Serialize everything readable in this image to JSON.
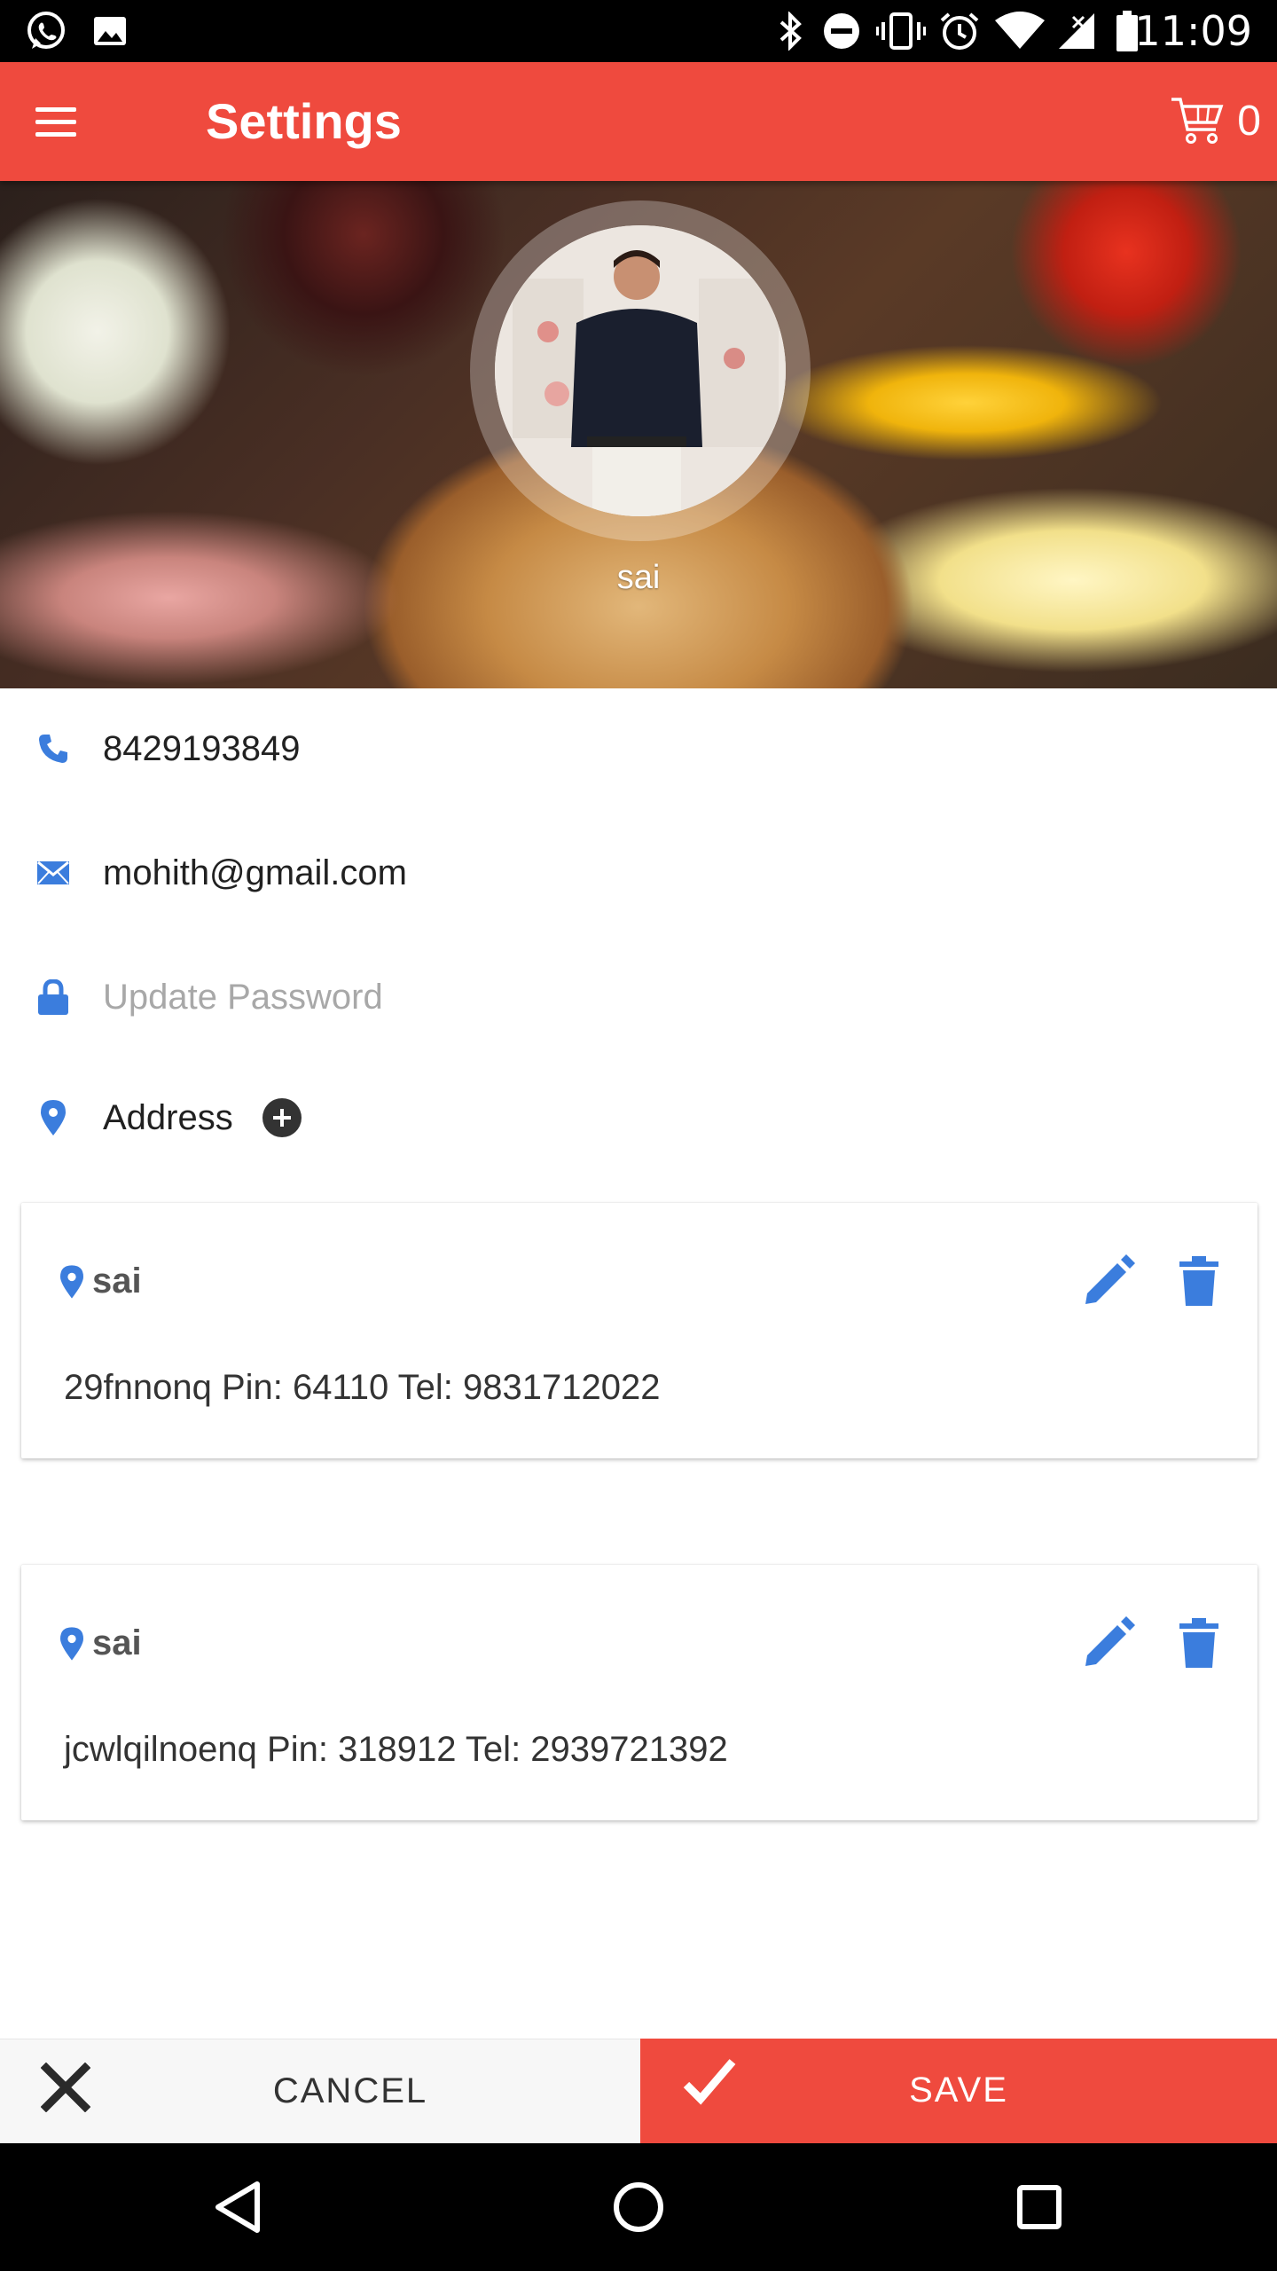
{
  "status_bar": {
    "time": "11:09",
    "left_icons": [
      "whatsapp-icon",
      "image-icon"
    ],
    "right_icons": [
      "bluetooth-icon",
      "do-not-disturb-icon",
      "vibrate-icon",
      "alarm-icon",
      "wifi-icon",
      "cell-signal-icon",
      "battery-icon"
    ]
  },
  "app_bar": {
    "title": "Settings",
    "cart_count": "0",
    "accent_color": "#ef4a3e"
  },
  "profile": {
    "name": "sai"
  },
  "contact": {
    "phone": "8429193849",
    "email": "mohith@gmail.com",
    "password_placeholder": "Update Password",
    "address_label": "Address"
  },
  "addresses": [
    {
      "name": "sai",
      "detail": "29fnnonq Pin: 64110 Tel: 9831712022"
    },
    {
      "name": "sai",
      "detail": "jcwlqilnoenq Pin: 318912 Tel: 2939721392"
    }
  ],
  "actions": {
    "cancel_label": "CANCEL",
    "save_label": "SAVE"
  },
  "colors": {
    "icon_blue": "#3b7ddd",
    "primary_red": "#ef4a3e"
  }
}
